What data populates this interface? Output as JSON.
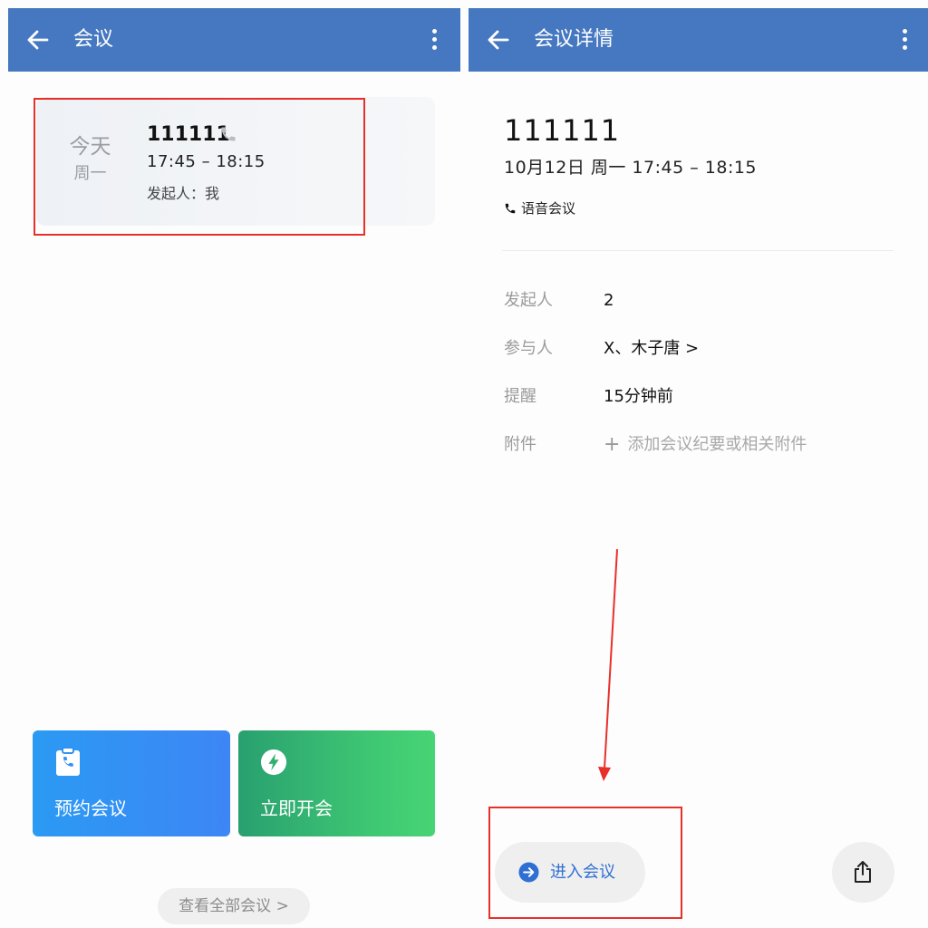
{
  "left": {
    "header": {
      "title": "会议"
    },
    "meeting_card": {
      "day": "今天",
      "weekday": "周一",
      "name": "111111",
      "time": "17:45 – 18:15",
      "host": "发起人：我"
    },
    "actions": {
      "schedule_label": "预约会议",
      "instant_label": "立即开会"
    },
    "view_all_label": "查看全部会议 >"
  },
  "right": {
    "header": {
      "title": "会议详情"
    },
    "meeting": {
      "title": "111111",
      "datetime": "10月12日 周一 17:45 – 18:15",
      "type": "语音会议"
    },
    "fields": {
      "host_label": "发起人",
      "host_value": "2",
      "participants_label": "参与人",
      "participants_value": "X、木子唐 >",
      "reminder_label": "提醒",
      "reminder_value": "15分钟前",
      "attachment_label": "附件",
      "attachment_value": "添加会议纪要或相关附件",
      "attachment_plus": "+"
    },
    "join_label": "进入会议"
  },
  "colors": {
    "appbar": "#4578c0",
    "annotation_red": "#e8302a",
    "join_blue": "#2f6fd3",
    "schedule_tile": "#3391f4",
    "instant_tile": "#3dbf73"
  }
}
